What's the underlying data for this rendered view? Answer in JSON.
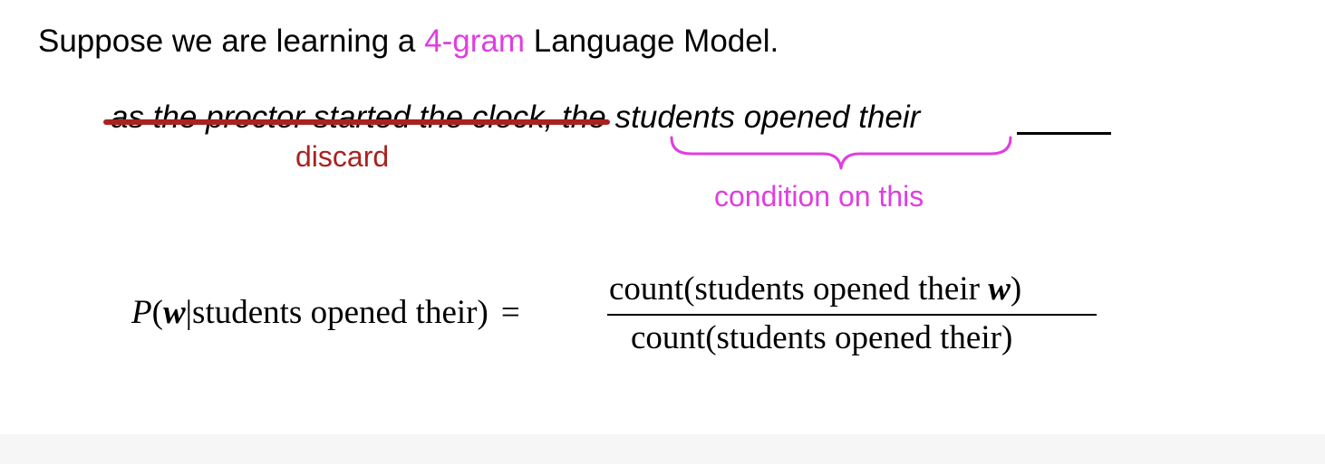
{
  "headline": {
    "prefix": "Suppose we are learning a ",
    "highlight": "4-gram",
    "suffix": " Language Model."
  },
  "sentence": {
    "discarded": "as the proctor started the clock, the",
    "kept": "students opened their"
  },
  "annotations": {
    "discard_label": "discard",
    "condition_label": "condition on this"
  },
  "equation": {
    "lhs_p": "P",
    "lhs_open": "(",
    "var_w": "w",
    "bar": "|",
    "lhs_context": "students opened their",
    "lhs_close": ")",
    "equals": "=",
    "numerator_prefix": "count(students opened their ",
    "numerator_var": "w",
    "numerator_suffix": ")",
    "denominator": "count(students opened their)"
  },
  "colors": {
    "highlight": "#e03ee0",
    "discard": "#a8231f",
    "text": "#000000"
  }
}
